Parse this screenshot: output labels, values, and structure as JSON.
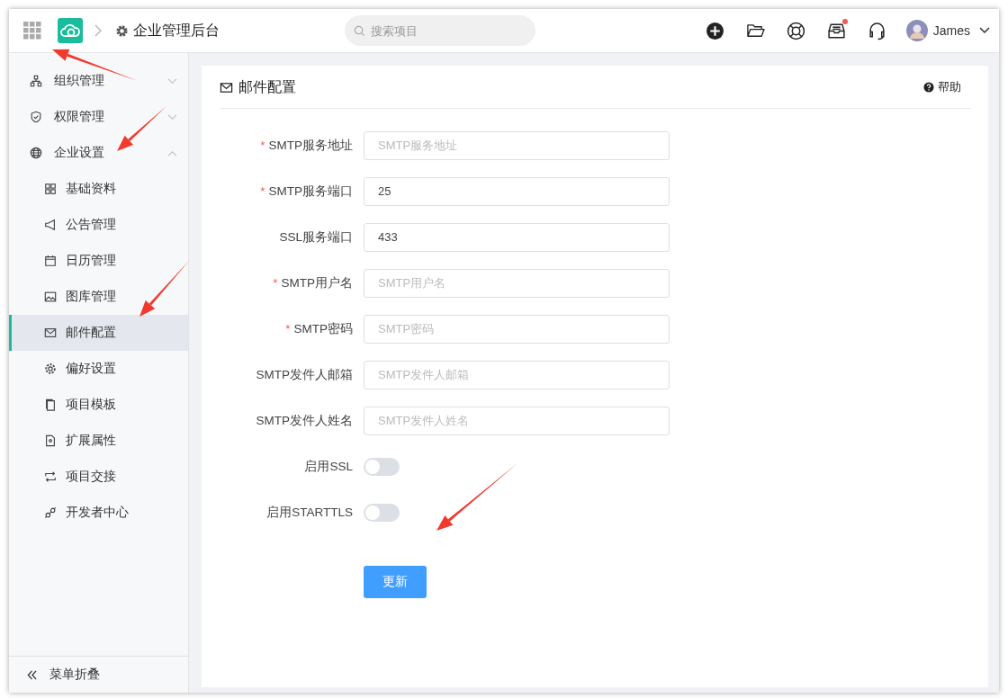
{
  "topbar": {
    "title": "企业管理后台",
    "search": {
      "placeholder": "搜索项目"
    },
    "notification_dot": true,
    "user": {
      "name": "James"
    }
  },
  "sidebar": {
    "items": [
      {
        "label": "组织管理",
        "expanded": false
      },
      {
        "label": "权限管理",
        "expanded": false
      },
      {
        "label": "企业设置",
        "expanded": true,
        "children": [
          {
            "label": "基础资料",
            "selected": false
          },
          {
            "label": "公告管理",
            "selected": false
          },
          {
            "label": "日历管理",
            "selected": false
          },
          {
            "label": "图库管理",
            "selected": false
          },
          {
            "label": "邮件配置",
            "selected": true
          },
          {
            "label": "偏好设置",
            "selected": false
          },
          {
            "label": "项目模板",
            "selected": false
          },
          {
            "label": "扩展属性",
            "selected": false
          },
          {
            "label": "项目交接",
            "selected": false
          },
          {
            "label": "开发者中心",
            "selected": false
          }
        ]
      }
    ],
    "collapse": "菜单折叠"
  },
  "panel": {
    "title": "邮件配置",
    "help": "帮助",
    "fields": [
      {
        "kind": "text",
        "required_mark": "*",
        "label": "SMTP服务地址",
        "placeholder": "SMTP服务地址"
      },
      {
        "kind": "text",
        "required_mark": "*",
        "label": "SMTP服务端口",
        "value": "25"
      },
      {
        "kind": "text",
        "label": "SSL服务端口",
        "value": "433"
      },
      {
        "kind": "text",
        "required_mark": "*",
        "label": "SMTP用户名",
        "placeholder": "SMTP用户名"
      },
      {
        "kind": "text",
        "required_mark": "*",
        "label": "SMTP密码",
        "placeholder": "SMTP密码"
      },
      {
        "kind": "text",
        "label": "SMTP发件人邮箱",
        "placeholder": "SMTP发件人邮箱"
      },
      {
        "kind": "text",
        "label": "SMTP发件人姓名",
        "placeholder": "SMTP发件人姓名"
      },
      {
        "kind": "switch",
        "label": "启用SSL",
        "on": false
      },
      {
        "kind": "switch",
        "label": "启用STARTTLS",
        "on": false
      }
    ],
    "submit": "更新"
  }
}
